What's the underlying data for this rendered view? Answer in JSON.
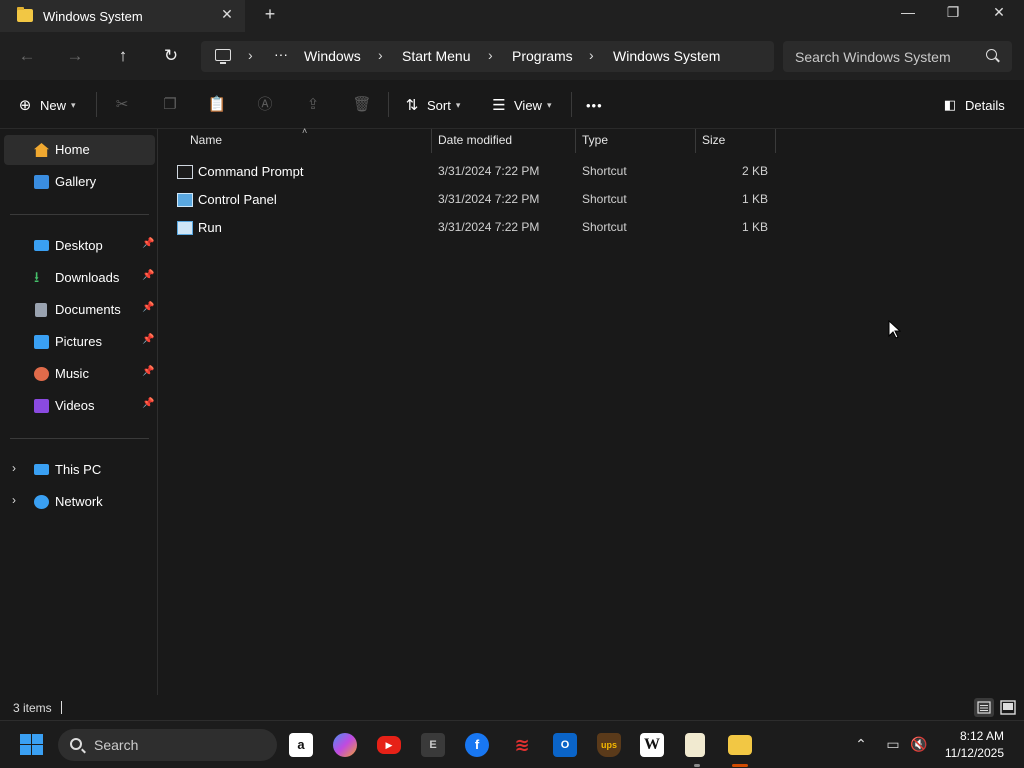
{
  "window": {
    "tab_title": "Windows System",
    "close_tab": "✕",
    "new_tab": "+",
    "minimize": "—",
    "restore": "❐",
    "close": "✕"
  },
  "nav": {
    "back": "←",
    "forward": "→",
    "up": "↑",
    "refresh": "↻",
    "ellipsis": "···",
    "breadcrumb": [
      "Windows",
      "Start Menu",
      "Programs",
      "Windows System"
    ],
    "separator": "›"
  },
  "search": {
    "placeholder": "Search Windows System"
  },
  "toolbar": {
    "new_label": "New",
    "sort_label": "Sort",
    "view_label": "View",
    "more_label": "•••",
    "details_label": "Details",
    "icons": [
      "cut-icon",
      "copy-icon",
      "paste-icon",
      "rename-icon",
      "share-icon",
      "delete-icon"
    ]
  },
  "sidebar": {
    "items": [
      {
        "label": "Home",
        "icon": "home-icon",
        "color": "#f0a830"
      },
      {
        "label": "Gallery",
        "icon": "gallery-icon",
        "color": "#3a8de0"
      },
      {
        "label": "Desktop",
        "icon": "desktop-icon",
        "color": "#3aa0f3",
        "pinned": true
      },
      {
        "label": "Downloads",
        "icon": "downloads-icon",
        "color": "#45c06a",
        "pinned": true
      },
      {
        "label": "Documents",
        "icon": "documents-icon",
        "color": "#9aa3b0",
        "pinned": true
      },
      {
        "label": "Pictures",
        "icon": "pictures-icon",
        "color": "#3aa0f3",
        "pinned": true
      },
      {
        "label": "Music",
        "icon": "music-icon",
        "color": "#e06b4a",
        "pinned": true
      },
      {
        "label": "Videos",
        "icon": "videos-icon",
        "color": "#8a4ae0",
        "pinned": true
      },
      {
        "label": "This PC",
        "icon": "this-pc-icon",
        "color": "#3aa0f3"
      },
      {
        "label": "Network",
        "icon": "network-icon",
        "color": "#3aa0f3"
      }
    ],
    "pin_glyph": "📌",
    "expand_glyph": "›"
  },
  "columns": {
    "name": "Name",
    "date": "Date modified",
    "type": "Type",
    "size": "Size"
  },
  "files": [
    {
      "name": "Command Prompt",
      "date": "3/31/2024 7:22 PM",
      "type": "Shortcut",
      "size": "2 KB",
      "icon": "command-prompt-icon"
    },
    {
      "name": "Control Panel",
      "date": "3/31/2024 7:22 PM",
      "type": "Shortcut",
      "size": "1 KB",
      "icon": "control-panel-icon"
    },
    {
      "name": "Run",
      "date": "3/31/2024 7:22 PM",
      "type": "Shortcut",
      "size": "1 KB",
      "icon": "run-icon"
    }
  ],
  "status": {
    "item_count": "3 items"
  },
  "taskbar": {
    "search_label": "Search",
    "apps": [
      "amazon-icon",
      "copilot-icon",
      "youtube-icon",
      "epic-icon",
      "facebook-icon",
      "app-red-icon",
      "outlook-icon",
      "ups-icon",
      "wikipedia-icon",
      "notepad-icon",
      "file-explorer-icon"
    ],
    "time": "8:12 AM",
    "date": "11/12/2025"
  }
}
